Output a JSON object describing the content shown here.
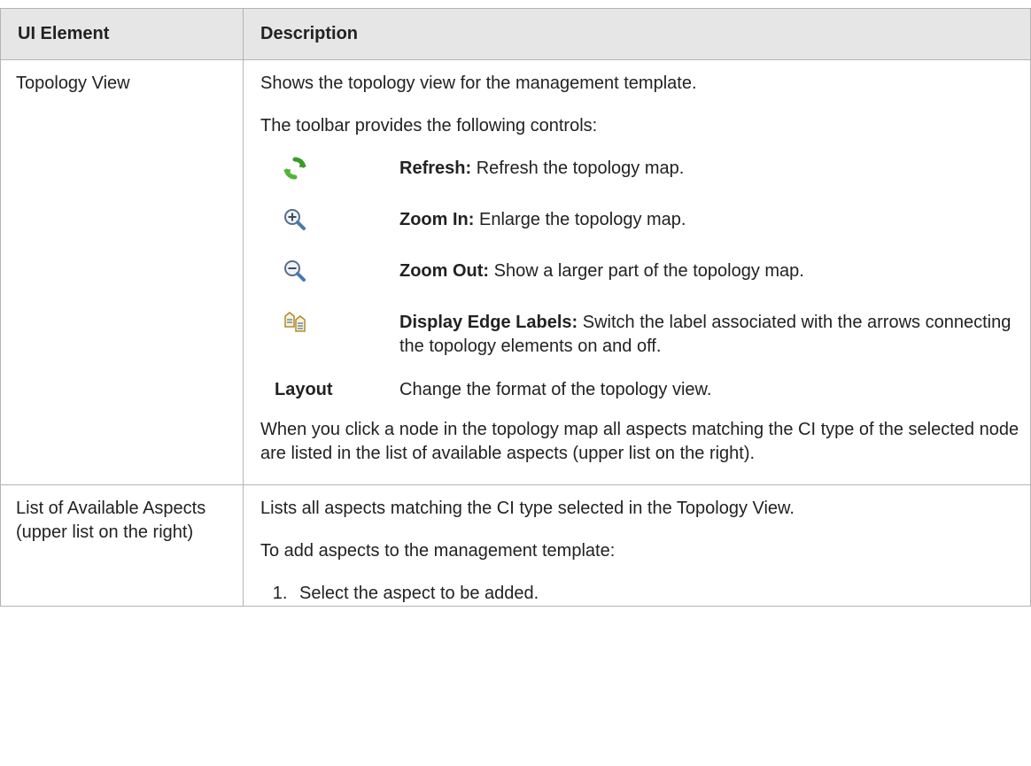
{
  "table": {
    "headers": [
      "UI Element",
      "Description"
    ],
    "rows": [
      {
        "element": "Topology View",
        "intro": "Shows the topology view for the management template.",
        "toolbar_intro": "The toolbar provides the following controls:",
        "controls": [
          {
            "icon": "refresh-icon",
            "name": "Refresh:",
            "desc": "Refresh the topology map."
          },
          {
            "icon": "zoom-in-icon",
            "name": "Zoom In:",
            "desc": "Enlarge the topology map."
          },
          {
            "icon": "zoom-out-icon",
            "name": "Zoom Out:",
            "desc": "Show a larger part of the topology map."
          },
          {
            "icon": "display-edge-labels-icon",
            "name": "Display Edge Labels:",
            "desc": "Switch the label associated with the arrows connecting the topology elements on and off."
          }
        ],
        "layout": {
          "label": "Layout",
          "desc": "Change the format of the topology view."
        },
        "note": "When you click a node in the topology map all aspects matching the CI type of the selected node are listed in the list of available aspects (upper list on the right)."
      },
      {
        "element": "List of Available Aspects (upper list on the right)",
        "intro": "Lists all aspects matching the CI type selected in the Topology View.",
        "steps_intro": "To add aspects to the management template:",
        "steps": [
          "Select the aspect to be added."
        ]
      }
    ]
  },
  "colors": {
    "header_bg": "#e6e6e6",
    "border": "#b4b4b4",
    "refresh_green": "#3a9a2a",
    "zoom_blue": "#4a78b0"
  }
}
